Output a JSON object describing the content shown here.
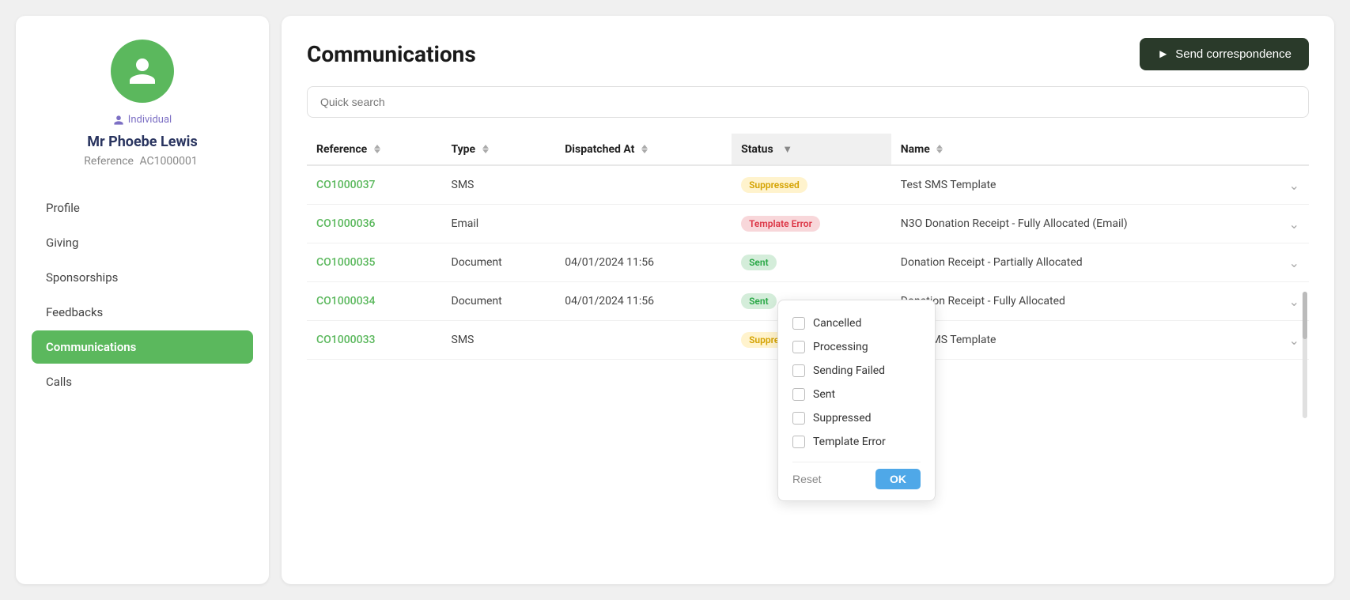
{
  "sidebar": {
    "avatar_color": "#5bb85d",
    "individual_label": "Individual",
    "person_name": "Mr Phoebe Lewis",
    "reference_label": "Reference",
    "reference_value": "AC1000001",
    "nav_items": [
      {
        "id": "profile",
        "label": "Profile",
        "active": false
      },
      {
        "id": "giving",
        "label": "Giving",
        "active": false
      },
      {
        "id": "sponsorships",
        "label": "Sponsorships",
        "active": false
      },
      {
        "id": "feedbacks",
        "label": "Feedbacks",
        "active": false
      },
      {
        "id": "communications",
        "label": "Communications",
        "active": true
      },
      {
        "id": "calls",
        "label": "Calls",
        "active": false
      }
    ]
  },
  "main": {
    "title": "Communications",
    "send_btn_label": "Send correspondence",
    "search_placeholder": "Quick search",
    "table": {
      "columns": [
        {
          "id": "reference",
          "label": "Reference",
          "sortable": true
        },
        {
          "id": "type",
          "label": "Type",
          "sortable": true,
          "filterable": false
        },
        {
          "id": "dispatched_at",
          "label": "Dispatched At",
          "sortable": true
        },
        {
          "id": "status",
          "label": "Status",
          "sortable": false,
          "filterable": true
        },
        {
          "id": "name",
          "label": "Name",
          "sortable": true
        }
      ],
      "rows": [
        {
          "reference": "CO1000037",
          "type": "SMS",
          "dispatched_at": "",
          "status": "Suppressed",
          "status_type": "suppressed",
          "name": "Test SMS Template"
        },
        {
          "reference": "CO1000036",
          "type": "Email",
          "dispatched_at": "",
          "status": "Template Error",
          "status_type": "template-error",
          "name": "N3O Donation Receipt - Fully Allocated (Email)"
        },
        {
          "reference": "CO1000035",
          "type": "Document",
          "dispatched_at": "04/01/2024 11:56",
          "status": "Sent",
          "status_type": "sent",
          "name": "Donation Receipt - Partially Allocated"
        },
        {
          "reference": "CO1000034",
          "type": "Document",
          "dispatched_at": "04/01/2024 11:56",
          "status": "Sent",
          "status_type": "sent",
          "name": "Donation Receipt - Fully Allocated"
        },
        {
          "reference": "CO1000033",
          "type": "SMS",
          "dispatched_at": "",
          "status": "Suppressed",
          "status_type": "suppressed",
          "name": "Test SMS Template"
        }
      ]
    },
    "filter_dropdown": {
      "options": [
        {
          "id": "cancelled",
          "label": "Cancelled",
          "checked": false
        },
        {
          "id": "processing",
          "label": "Processing",
          "checked": false
        },
        {
          "id": "sending_failed",
          "label": "Sending Failed",
          "checked": false
        },
        {
          "id": "sent",
          "label": "Sent",
          "checked": false
        },
        {
          "id": "suppressed",
          "label": "Suppressed",
          "checked": false
        },
        {
          "id": "template_error",
          "label": "Template Error",
          "checked": false
        }
      ],
      "reset_label": "Reset",
      "ok_label": "OK"
    }
  }
}
